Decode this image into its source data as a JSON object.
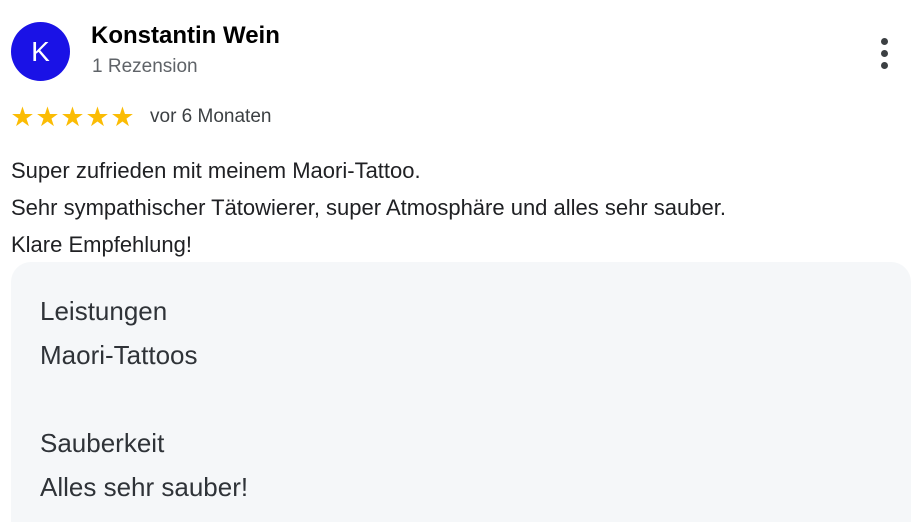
{
  "author": {
    "initial": "K",
    "name": "Konstantin Wein",
    "review_count": "1 Rezension"
  },
  "rating": {
    "stars": 5,
    "max_stars": 5,
    "date": "vor 6 Monaten"
  },
  "review_text": [
    "Super zufrieden mit meinem Maori-Tattoo.",
    "Sehr sympathischer Tätowierer, super Atmosphäre und alles sehr sauber.",
    "Klare Empfehlung!"
  ],
  "details": [
    {
      "label": "Leistungen",
      "value": "Maori-Tattoos"
    },
    {
      "label": "Sauberkeit",
      "value": "Alles sehr sauber!"
    }
  ],
  "icons": {
    "menu": "more-vert-icon",
    "star": "star-icon"
  },
  "colors": {
    "avatar": "#1a12e6",
    "star": "#fbbc04",
    "details_background": "#f5f7f9"
  }
}
